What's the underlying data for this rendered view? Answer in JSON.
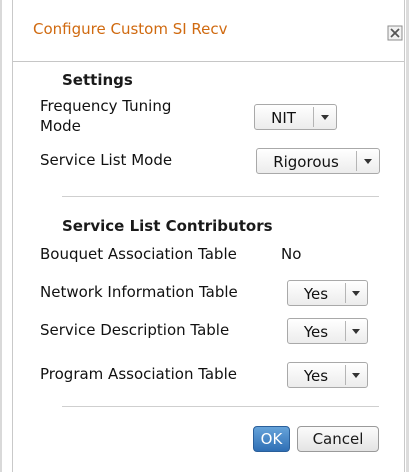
{
  "dialog": {
    "title": "Configure Custom SI Recv",
    "title_color": "#d06a10"
  },
  "settings": {
    "heading": "Settings",
    "frequency_tuning_mode": {
      "label_line1": "Frequency Tuning",
      "label_line2": "Mode",
      "value": "NIT"
    },
    "service_list_mode": {
      "label": "Service List Mode",
      "value": "Rigorous"
    }
  },
  "contributors": {
    "heading": "Service List Contributors",
    "bouquet_association_table": {
      "label": "Bouquet Association Table",
      "value": "No"
    },
    "network_information_table": {
      "label": "Network Information Table",
      "value": "Yes"
    },
    "service_description_table": {
      "label": "Service Description Table",
      "value": "Yes"
    },
    "program_association_table": {
      "label": "Program Association Table",
      "value": "Yes"
    }
  },
  "buttons": {
    "ok_label": "OK",
    "cancel_label": "Cancel",
    "ok_color": "#3b7bc0"
  },
  "icons": {
    "close": "close-icon",
    "dropdown": "chevron-down-icon"
  }
}
